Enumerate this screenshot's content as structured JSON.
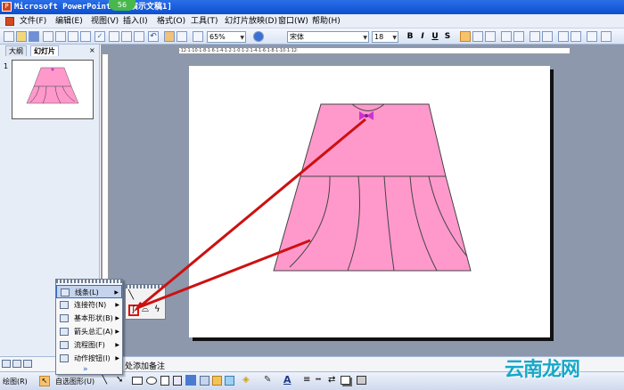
{
  "window": {
    "title": "Microsoft PowerPoint - [演示文稿1]",
    "badge": "56"
  },
  "menu": {
    "items": [
      "文件(F)",
      "编辑(E)",
      "视图(V)",
      "插入(I)",
      "格式(O)",
      "工具(T)",
      "幻灯片放映(D)",
      "窗口(W)",
      "帮助(H)"
    ]
  },
  "toolbar": {
    "zoom": "65%",
    "font_name": "宋体",
    "font_size": "18",
    "bold": "B",
    "italic": "I",
    "underline": "U",
    "shadow": "S"
  },
  "panes": {
    "tab_outline": "大纲",
    "tab_slides": "幻灯片",
    "slide_number": "1"
  },
  "ruler": {
    "labels": "·12·1·10·1·8·1·6·1·4·1·2·1·0·1·2·1·4·1·6·1·8·1·10·1·12·"
  },
  "notes": {
    "placeholder": "处添加备注"
  },
  "autoshapes_menu": {
    "items": [
      {
        "label": "线条(L)",
        "icon": "lines-icon"
      },
      {
        "label": "连接符(N)",
        "icon": "connector-icon"
      },
      {
        "label": "基本形状(B)",
        "icon": "basic-shapes-icon"
      },
      {
        "label": "箭头总汇(A)",
        "icon": "block-arrows-icon"
      },
      {
        "label": "流程图(F)",
        "icon": "flowchart-icon"
      },
      {
        "label": "动作按钮(I)",
        "icon": "action-button-icon"
      }
    ],
    "expand": "»"
  },
  "drawing_toolbar": {
    "draw_label": "绘图(R)",
    "autoshapes_label": "自选图形(U)"
  },
  "colors": {
    "dress_fill": "#ff99cc",
    "bow": "#cc33cc",
    "arrow": "#cc1111",
    "highlight_box": "#dd1111",
    "titlebar": "#0b4fd1"
  },
  "watermark": {
    "text": "云南龙网"
  }
}
